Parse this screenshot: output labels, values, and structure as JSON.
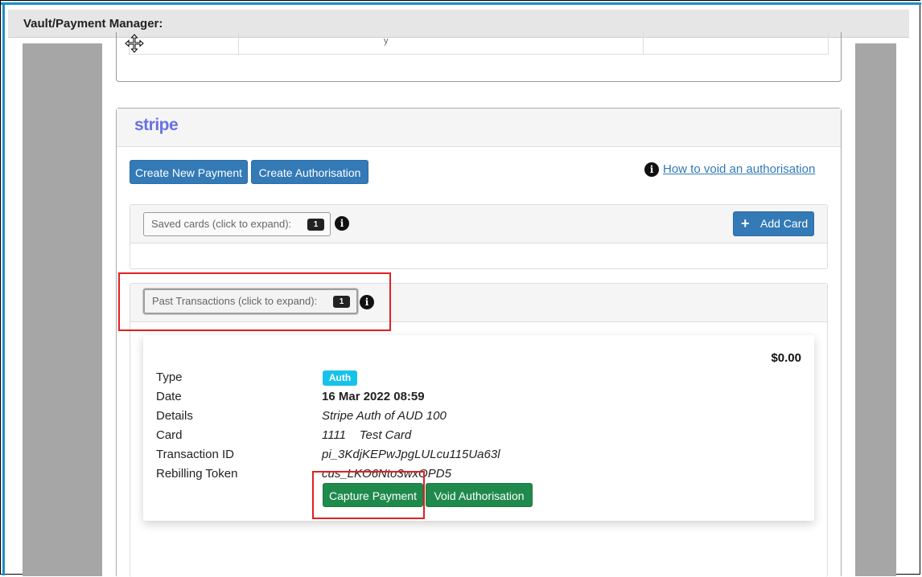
{
  "dialog": {
    "title": "Vault/Payment Manager:"
  },
  "stripe": {
    "logo": "stripe",
    "buttons": {
      "create_payment": "Create New Payment",
      "create_authorisation": "Create Authorisation"
    },
    "help_link": "How to void an authorisation"
  },
  "saved_cards": {
    "label": "Saved cards (click to expand):",
    "count": "1",
    "add_card": "Add Card"
  },
  "past_transactions": {
    "label": "Past Transactions (click to expand):",
    "count": "1"
  },
  "transaction": {
    "amount": "$0.00",
    "labels": {
      "type": "Type",
      "date": "Date",
      "details": "Details",
      "card": "Card",
      "transaction_id": "Transaction ID",
      "rebilling_token": "Rebilling Token"
    },
    "type_badge": "Auth",
    "date": "16 Mar 2022 08:59",
    "details": "Stripe Auth of AUD 100",
    "card": "1111    Test Card",
    "transaction_id": "pi_3KdjKEPwJpgLULcu115Ua63l",
    "rebilling_token": "cus_LKO6Nto3wxOPD5",
    "actions": {
      "capture": "Capture Payment",
      "void": "Void Authorisation"
    }
  },
  "colors": {
    "primary": "#337ab7",
    "success": "#1f8a4c",
    "info": "#17c2e8",
    "stripe": "#6772e5",
    "highlight": "#e32020"
  },
  "icons": {
    "move": "move-cursor-icon",
    "info": "info-circle-icon",
    "plus": "plus-icon"
  }
}
